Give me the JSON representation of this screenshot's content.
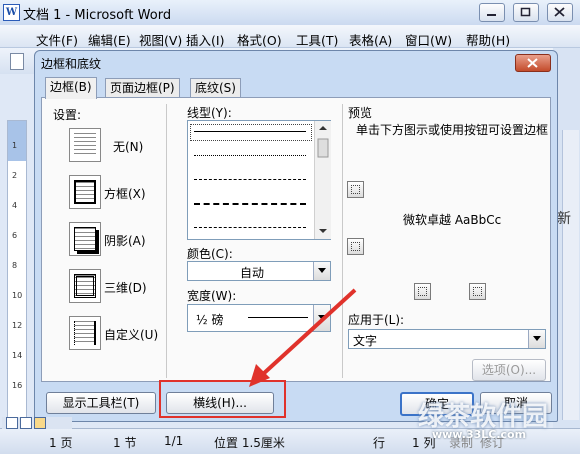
{
  "window": {
    "app_icon": "W",
    "title": "文档 1 - Microsoft Word"
  },
  "menu": [
    "文件(F)",
    "编辑(E)",
    "视图(V)",
    "插入(I)",
    "格式(O)",
    "工具(T)",
    "表格(A)",
    "窗口(W)",
    "帮助(H)"
  ],
  "dialog": {
    "title": "边框和底纹",
    "tabs": [
      "边框(B)",
      "页面边框(P)",
      "底纹(S)"
    ],
    "setting_label": "设置:",
    "settings": [
      "无(N)",
      "方框(X)",
      "阴影(A)",
      "三维(D)",
      "自定义(U)"
    ],
    "line_style_label": "线型(Y):",
    "color_label": "颜色(C):",
    "color_value": "自动",
    "width_label": "宽度(W):",
    "width_value": "½ 磅",
    "preview_label": "预览",
    "preview_hint": "单击下方图示或使用按钮可设置边框",
    "preview_sample": "微软卓越  AaBbCc",
    "apply_label": "应用于(L):",
    "apply_value": "文字",
    "options_button": "选项(O)...",
    "show_toolbar_button": "显示工具栏(T)",
    "horizontal_line_button": "横线(H)...",
    "ok_button": "确定",
    "cancel_button": "取消"
  },
  "status": {
    "page": "1 页",
    "section": "1 节",
    "pages": "1/1",
    "position": "位置 1.5厘米",
    "line": "行",
    "col": "1 列",
    "rec": "录制",
    "rev": "修订"
  },
  "ruler_numbers": [
    "1",
    "2",
    "4",
    "6",
    "8",
    "10",
    "12",
    "14",
    "16"
  ],
  "right_chars": [
    "新"
  ],
  "watermark": {
    "main": "绿茶软件园",
    "url": "www.33LC.com"
  },
  "colors": {
    "highlight": "#e0322b",
    "dialog_frame": "#c8dbf3",
    "accent": "#1b4ea8"
  }
}
